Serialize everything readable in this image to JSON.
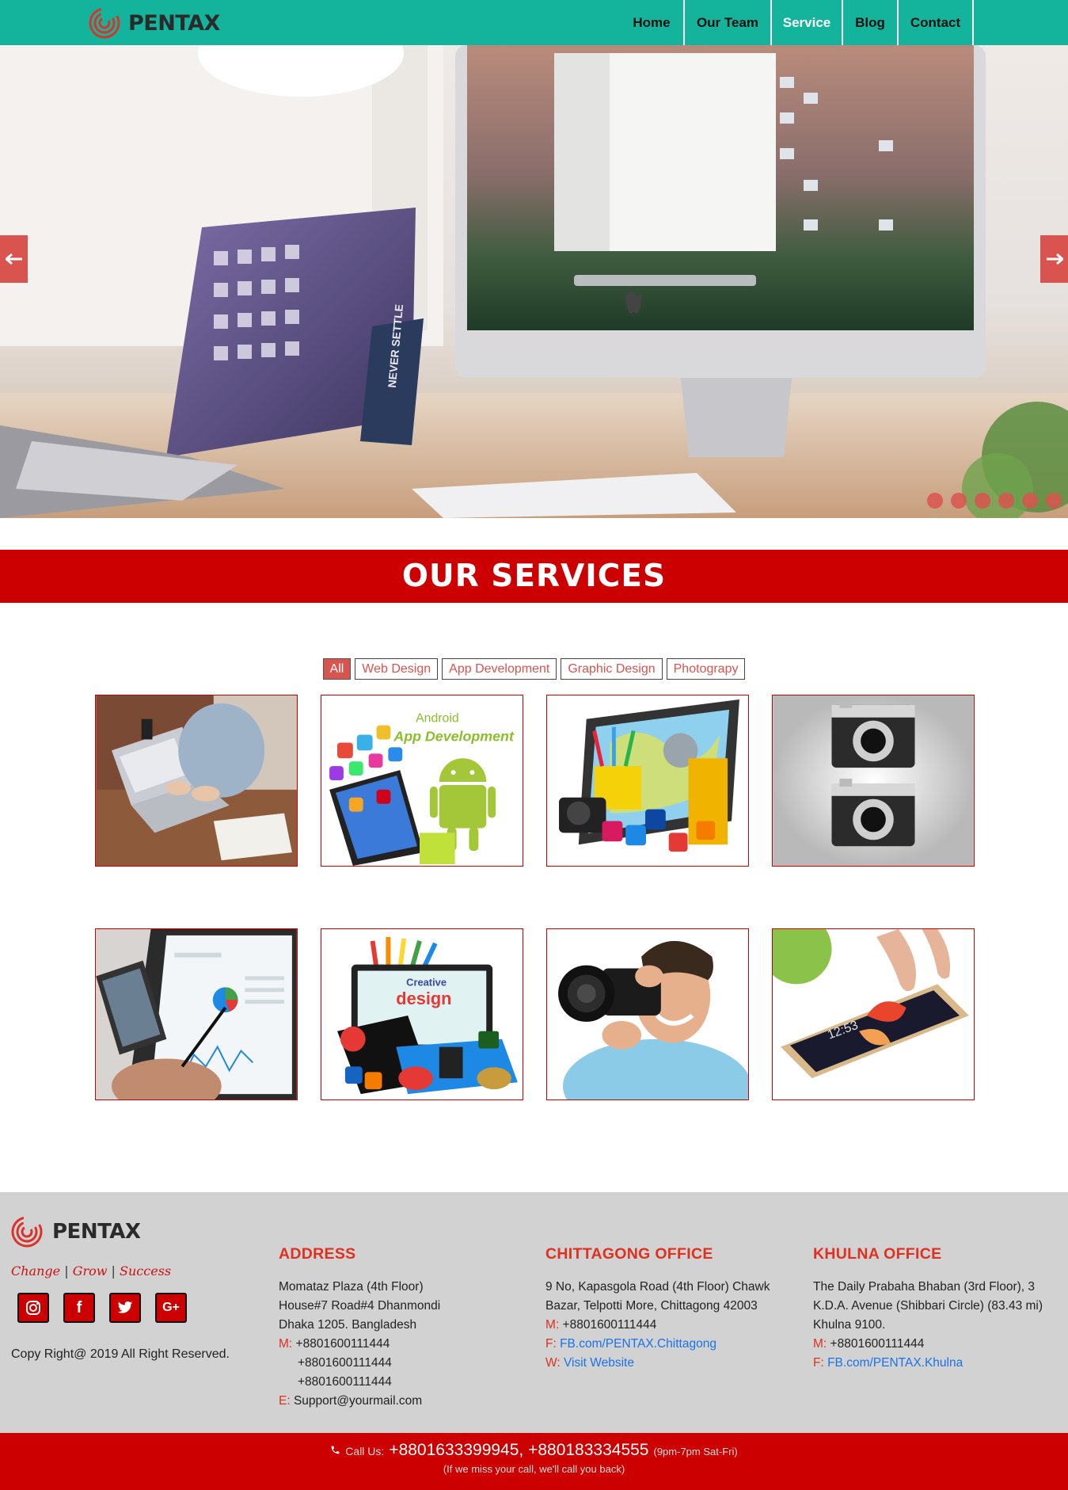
{
  "brand": {
    "name": "PENTAX"
  },
  "nav": {
    "items": [
      {
        "label": "Home"
      },
      {
        "label": "Our Team"
      },
      {
        "label": "Service"
      },
      {
        "label": "Blog"
      },
      {
        "label": "Contact"
      }
    ],
    "active": "Service"
  },
  "hero": {
    "slide_count": 6,
    "prev_icon": "arrow-left-icon",
    "next_icon": "arrow-right-icon",
    "sign_text": "NEVER SETTLE"
  },
  "services": {
    "title": "OUR SERVICES",
    "filters": [
      "All",
      "Web Design",
      "App Development",
      "Graphic Design",
      "Photograpy"
    ],
    "active_filter": "All",
    "tiles": [
      {
        "subject": "laptop-typing"
      },
      {
        "subject": "android-app",
        "line1": "Android",
        "line2": "App Development"
      },
      {
        "subject": "graphic-tablet"
      },
      {
        "subject": "vintage-cameras"
      },
      {
        "subject": "tablet-chart"
      },
      {
        "subject": "creative-design",
        "line1": "Creative",
        "line2": "design"
      },
      {
        "subject": "photographer"
      },
      {
        "subject": "smartphone-touch",
        "line1": "12:53"
      }
    ]
  },
  "footer": {
    "brand": "PENTAX",
    "tagline": [
      "Change",
      "Grow",
      "Success"
    ],
    "tagline_separator": "|",
    "socials": [
      {
        "icon": "instagram-icon",
        "glyph": "◎"
      },
      {
        "icon": "facebook-icon",
        "glyph": "f"
      },
      {
        "icon": "twitter-icon",
        "glyph": "🐦"
      },
      {
        "icon": "google-plus-icon",
        "glyph": "G+"
      }
    ],
    "copyright": "Copy Right@ 2019 All Right Reserved.",
    "address": {
      "title": "ADDRESS",
      "lines": [
        "Momataz Plaza (4th Floor)",
        "House#7 Road#4 Dhanmondi",
        "Dhaka 1205. Bangladesh"
      ],
      "m_label": "M:",
      "phones": [
        "+8801600111444",
        "+8801600111444",
        "+8801600111444"
      ],
      "e_label": "E:",
      "email": "Support@yourmail.com"
    },
    "chittagong": {
      "title": "CHITTAGONG OFFICE",
      "lines": [
        "9 No, Kapasgola Road (4th Floor) Chawk",
        "Bazar, Telpotti More, Chittagong 42003"
      ],
      "m_label": "M:",
      "phone": "+8801600111444",
      "f_label": "F:",
      "facebook": "FB.com/PENTAX.Chittagong",
      "w_label": "W:",
      "website": "Visit Website"
    },
    "khulna": {
      "title": "KHULNA OFFICE",
      "lines": [
        "The Daily Prabaha Bhaban (3rd Floor), 3",
        "K.D.A. Avenue (Shibbari Circle) (83.43 mi)",
        "Khulna 9100."
      ],
      "m_label": "M:",
      "phone": "+8801600111444",
      "f_label": "F:",
      "facebook": "FB.com/PENTAX.Khulna"
    },
    "callbar": {
      "call_label": "Call Us:",
      "phones": "+8801633399945, +880183334555",
      "hours": "(9pm-7pm Sat-Fri)",
      "note": "(If we miss your call, we'll call you back)",
      "phone_icon": "phone-icon"
    }
  },
  "colors": {
    "nav_bg": "#14b49c",
    "accent_red": "#cc0000",
    "soft_red": "#d9534f",
    "footer_bg": "#d2d2d2",
    "label_red": "#e03020",
    "link_blue": "#1a73e8"
  }
}
